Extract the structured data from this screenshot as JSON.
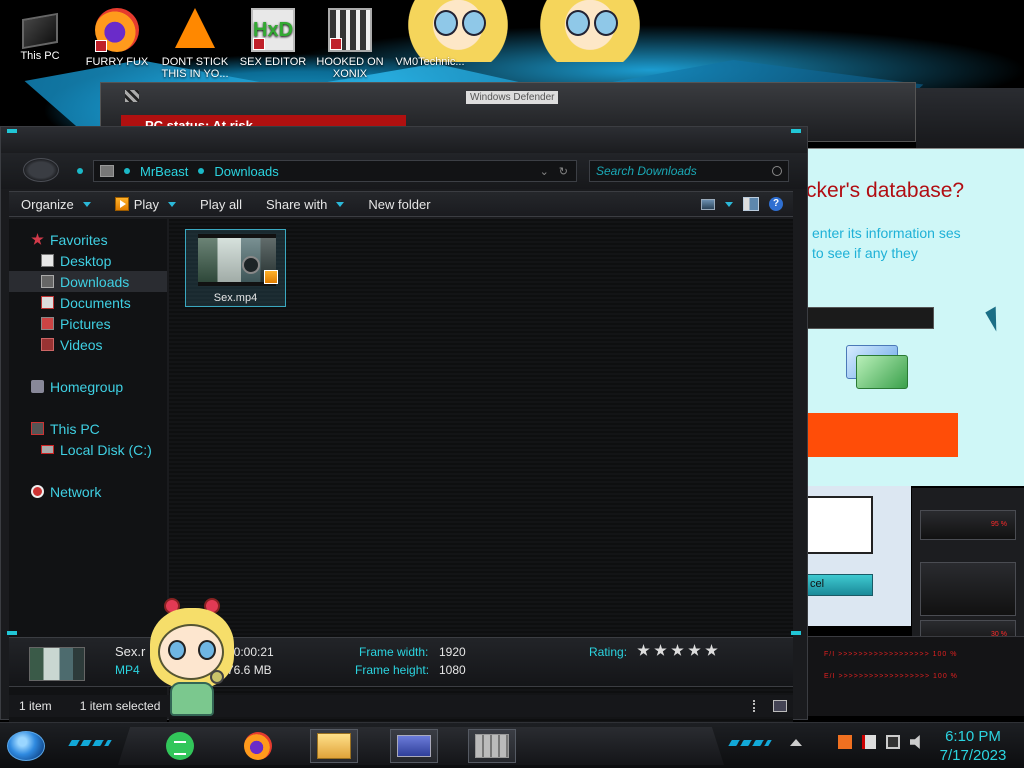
{
  "desktop": {
    "icons": [
      {
        "label": "This PC"
      },
      {
        "label": "FURRY FUX"
      },
      {
        "label": "DONT STICK THIS IN YO..."
      },
      {
        "label": "SEX EDITOR"
      },
      {
        "label": "HOOKED ON XONIX"
      },
      {
        "label": "VM0Technic..."
      }
    ]
  },
  "background_windows": {
    "tooltip_title": "Windows Defender",
    "pc_status": "PC status: At risk",
    "popup_heading": "cker's database?",
    "popup_desc": "enter its information ses to see if any they",
    "cancel_label": "cel",
    "hud_readings": [
      "95 %",
      "30 %",
      "100 %",
      "100 %"
    ]
  },
  "explorer": {
    "breadcrumb": [
      "MrBeast",
      "Downloads"
    ],
    "search_placeholder": "Search Downloads",
    "toolbar": {
      "organize": "Organize",
      "play": "Play",
      "play_all": "Play all",
      "share_with": "Share with",
      "new_folder": "New folder"
    },
    "nav": {
      "favorites": "Favorites",
      "desktop": "Desktop",
      "downloads": "Downloads",
      "documents": "Documents",
      "pictures": "Pictures",
      "videos": "Videos",
      "homegroup": "Homegroup",
      "this_pc": "This PC",
      "local_disk": "Local Disk (C:)",
      "network": "Network"
    },
    "files": [
      {
        "name": "Sex.mp4"
      }
    ],
    "details": {
      "name": "Sex.r",
      "type": "MP4",
      "length": "00:00:21",
      "size": "76.6 MB",
      "frame_width_label": "Frame width:",
      "frame_width": "1920",
      "frame_height_label": "Frame height:",
      "frame_height": "1080",
      "rating_label": "Rating:",
      "rating": 0
    },
    "status": {
      "count": "1 item",
      "selected": "1 item selected"
    }
  },
  "taskbar": {
    "time": "6:10 PM",
    "date": "7/17/2023"
  },
  "colors": {
    "accent": "#2bd4e0",
    "frame": "#1a1b1e",
    "alert_red": "#b01010",
    "orange_button": "#ff4d08"
  }
}
